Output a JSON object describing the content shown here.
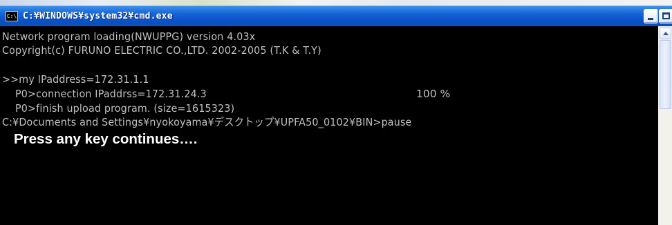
{
  "window": {
    "title": "C:¥WINDOWS¥system32¥cmd.exe",
    "icon_label": "C:\\",
    "buttons": {
      "minimize": "minimize-icon",
      "maximize": "maximize-icon",
      "close": "close-icon",
      "close_glyph": "×"
    },
    "colors": {
      "titlebar": "#0a53c6",
      "console_bg": "#000000",
      "console_text": "#c0c0c0"
    }
  },
  "console": {
    "lines": [
      "Network program loading(NWUPPG) version 4.03x",
      "Copyright(c) FURUNO ELECTRIC CO.,LTD. 2002-2005 (T.K & T.Y)",
      "",
      ">>my IPaddress=172.31.1.1",
      "P0>connection IPaddrss=172.31.24.3",
      "P0>finish upload program. (size=1615323)",
      "C:¥Documents and Settings¥nyokoyama¥デスクトップ¥UPFA50_0102¥BIN>pause"
    ],
    "progress_text": "100 %"
  },
  "caption": {
    "text": "Press any key continues…."
  }
}
